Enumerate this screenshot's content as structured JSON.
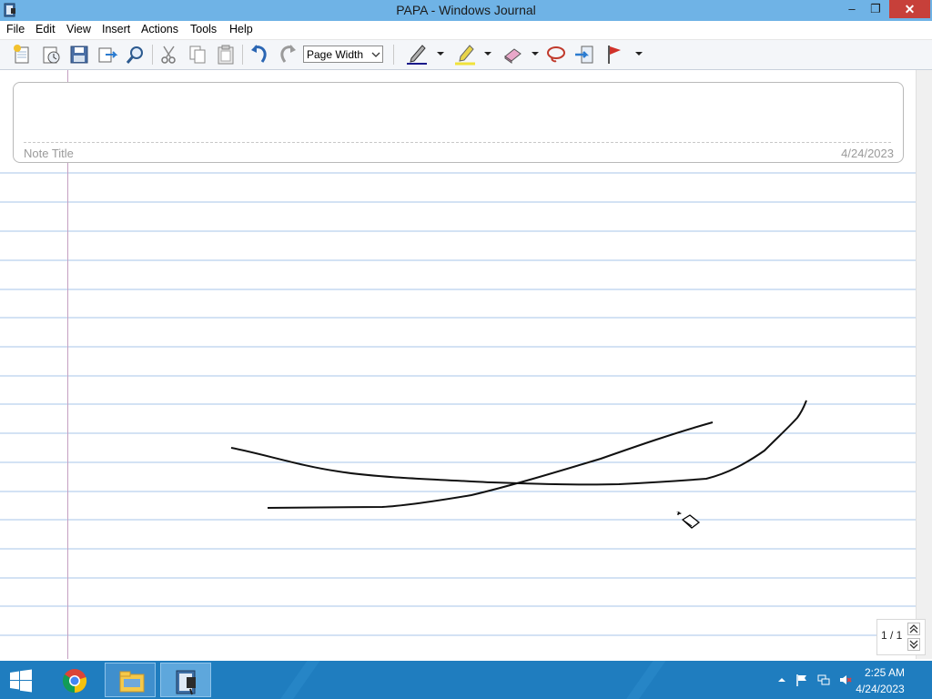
{
  "window": {
    "title": "PAPA - Windows Journal",
    "minimize": "–",
    "restore": "❐",
    "close": "✕"
  },
  "menu": [
    "File",
    "Edit",
    "View",
    "Insert",
    "Actions",
    "Tools",
    "Help"
  ],
  "toolbar": {
    "zoom_value": "Page Width",
    "icons": [
      "new-note-icon",
      "open-icon",
      "save-icon",
      "send-icon",
      "find-icon",
      "cut-icon",
      "copy-icon",
      "paste-icon",
      "undo-icon",
      "redo-icon",
      "pen-icon",
      "highlighter-icon",
      "eraser-icon",
      "lasso-icon",
      "insert-space-icon",
      "flag-icon"
    ],
    "active_tool": "eraser-icon"
  },
  "note": {
    "title_placeholder": "Note Title",
    "date": "4/24/2023"
  },
  "pager": {
    "page": "1 / 1"
  },
  "taskbar": {
    "apps": [
      "chrome-icon",
      "file-explorer-icon",
      "windows-journal-icon"
    ],
    "active_app": "windows-journal-icon",
    "time": "2:25 AM",
    "date": "4/24/2023"
  },
  "colors": {
    "titlebar": "#6fb3e6",
    "ruled_line": "#a7c6e8",
    "margin_line": "#c5a0c2",
    "taskbar": "#1f7dbf",
    "close_button": "#c7403a"
  }
}
